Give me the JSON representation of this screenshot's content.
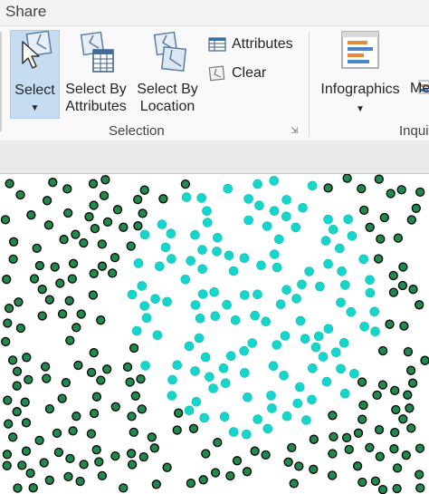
{
  "tabs": {
    "share": "Share"
  },
  "ribbon": {
    "select": {
      "label": "Select",
      "icon": "select-cursor-icon"
    },
    "select_by_attributes": {
      "line1": "Select By",
      "line2": "Attributes",
      "icon": "select-by-attributes-icon"
    },
    "select_by_location": {
      "line1": "Select By",
      "line2": "Location",
      "icon": "select-by-location-icon"
    },
    "attributes": {
      "label": "Attributes",
      "icon": "attributes-table-icon"
    },
    "clear": {
      "label": "Clear",
      "icon": "clear-selection-icon"
    },
    "selection_group_label": "Selection",
    "infographics": {
      "label": "Infographics",
      "icon": "infographics-icon"
    },
    "me_partial": "Me",
    "inquiry_group_label": "Inqui"
  },
  "map": {
    "unselected_color": "#1e8a4e",
    "selected_color": "#14d6cc",
    "outline_color": "#000000"
  }
}
